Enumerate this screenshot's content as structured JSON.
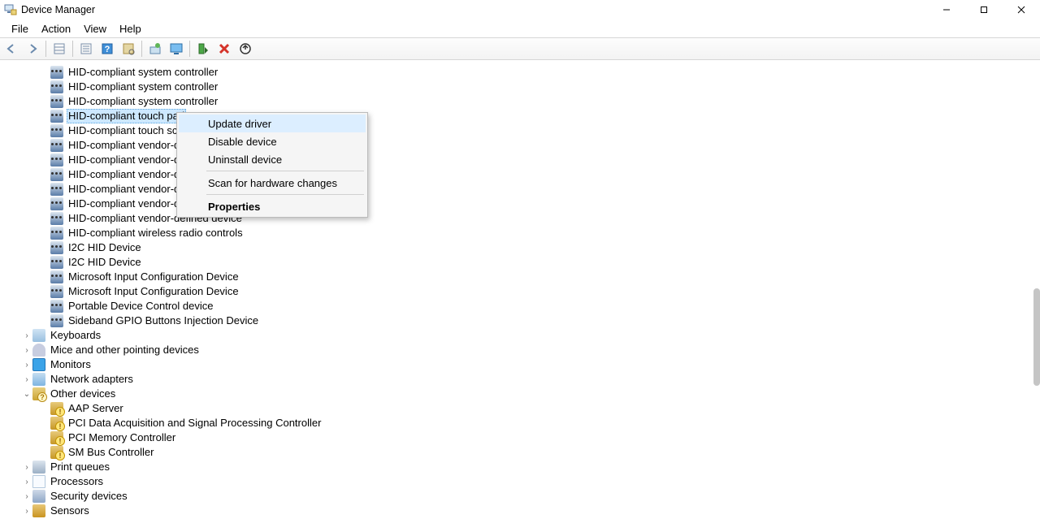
{
  "window": {
    "title": "Device Manager"
  },
  "menu": {
    "file": "File",
    "action": "Action",
    "view": "View",
    "help": "Help"
  },
  "devices": [
    "HID-compliant system controller",
    "HID-compliant system controller",
    "HID-compliant system controller",
    "HID-compliant touch pad",
    "HID-compliant touch screen",
    "HID-compliant vendor-defined device",
    "HID-compliant vendor-defined device",
    "HID-compliant vendor-defined device",
    "HID-compliant vendor-defined device",
    "HID-compliant vendor-defined device",
    "HID-compliant vendor-defined device",
    "HID-compliant wireless radio controls",
    "I2C HID Device",
    "I2C HID Device",
    "Microsoft Input Configuration Device",
    "Microsoft Input Configuration Device",
    "Portable Device Control device",
    "Sideband GPIO Buttons Injection Device"
  ],
  "selected_index": 3,
  "categories": [
    {
      "label": "Keyboards",
      "icon": "cat-kbd",
      "expanded": false
    },
    {
      "label": "Mice and other pointing devices",
      "icon": "cat-mouse",
      "expanded": false
    },
    {
      "label": "Monitors",
      "icon": "cat-mon",
      "expanded": false
    },
    {
      "label": "Network adapters",
      "icon": "cat-net",
      "expanded": false
    },
    {
      "label": "Other devices",
      "icon": "cat-other",
      "expanded": true
    },
    {
      "label": "Print queues",
      "icon": "cat-print",
      "expanded": false
    },
    {
      "label": "Processors",
      "icon": "cat-proc",
      "expanded": false
    },
    {
      "label": "Security devices",
      "icon": "cat-sec",
      "expanded": false
    },
    {
      "label": "Sensors",
      "icon": "cat-sens",
      "expanded": false
    }
  ],
  "other_devices": [
    "AAP Server",
    "PCI Data Acquisition and Signal Processing Controller",
    "PCI Memory Controller",
    "SM Bus Controller"
  ],
  "context_menu": {
    "update": "Update driver",
    "disable": "Disable device",
    "uninstall": "Uninstall device",
    "scan": "Scan for hardware changes",
    "props": "Properties"
  }
}
